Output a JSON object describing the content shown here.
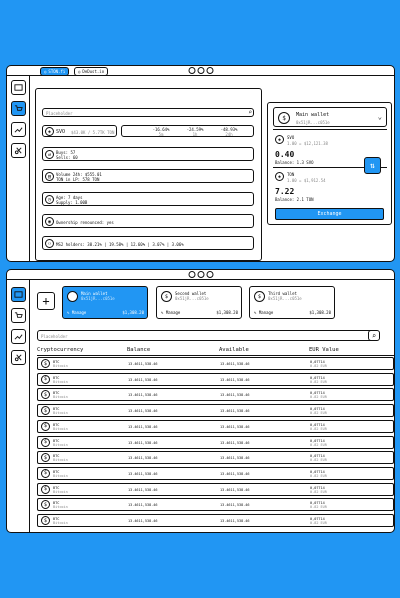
{
  "colors": {
    "accent": "#2196F3",
    "border": "#111111"
  },
  "top": {
    "tabs": [
      {
        "label": "STON.fi"
      },
      {
        "label": "DeDust.io"
      }
    ],
    "search_placeholder": "Placeholder",
    "token": {
      "symbol": "SVO",
      "price": "$43.0K / 5.7TK TON"
    },
    "changes": [
      {
        "value": "-16.64%",
        "period": "5m"
      },
      {
        "value": "-24.59%",
        "period": "1h"
      },
      {
        "value": "-48.93%",
        "period": "24h"
      }
    ],
    "stats": [
      {
        "icon": "swap-icon",
        "lines": [
          "Buys: 57",
          "Sells: 60"
        ]
      },
      {
        "icon": "chart-icon",
        "lines": [
          "Volume 24h: $555.01",
          "TON in LP: 578 TON"
        ]
      },
      {
        "icon": "clock-icon",
        "lines": [
          "Age: 7 days",
          "Supply: 1.00B"
        ]
      },
      {
        "icon": "user-icon",
        "lines": [
          "Ownership renounced: yes"
        ]
      },
      {
        "icon": "users-icon",
        "lines": [
          "MS2 holders: 30.21% | 19.58% | 12.60% | 3.07% | 3.06%"
        ]
      }
    ],
    "wallet_select": {
      "name": "Main wallet",
      "address": "0x51jR...c051e"
    },
    "assets": [
      {
        "symbol": "SVO",
        "rate": "1.00 = $12,121.38",
        "amount": "0.40",
        "balance": "Balance: 1.3 SVO"
      },
      {
        "symbol": "TON",
        "rate": "1.00 = $1,912.54",
        "amount": "7.22",
        "balance": "Balance: 2.1 TON"
      }
    ],
    "exchange_label": "Exchange"
  },
  "bottom": {
    "wallets": [
      {
        "name": "Main wallet",
        "address": "0x51jR...c051e",
        "manage": "Manage",
        "amount": "$1,308.20",
        "active": true
      },
      {
        "name": "Second wallet",
        "address": "0x51jR...c051e",
        "manage": "Manage",
        "amount": "$1,308.20",
        "active": false
      },
      {
        "name": "Third wallet",
        "address": "0x51jR...c051e",
        "manage": "Manage",
        "amount": "$1,308.20",
        "active": false
      }
    ],
    "search_placeholder": "Placeholder",
    "columns": [
      "Cryptocurrency",
      "Balance",
      "Available",
      "EUR Value"
    ],
    "rows": [
      {
        "symbol": "BTC",
        "name": "Bitcoin",
        "balance": "13.4611,538.46",
        "available": "13.4611,538.46",
        "eur": "0,07714",
        "eur_sub": "0.82 EUR"
      },
      {
        "symbol": "BTC",
        "name": "Bitcoin",
        "balance": "13.4611,538.46",
        "available": "13.4611,538.46",
        "eur": "0,07714",
        "eur_sub": "0.82 EUR"
      },
      {
        "symbol": "BTC",
        "name": "Bitcoin",
        "balance": "13.4611,538.46",
        "available": "13.4611,538.46",
        "eur": "0,07714",
        "eur_sub": "0.82 EUR"
      },
      {
        "symbol": "BTC",
        "name": "Bitcoin",
        "balance": "13.4611,538.46",
        "available": "13.4611,538.46",
        "eur": "0,07714",
        "eur_sub": "0.82 EUR"
      },
      {
        "symbol": "BTC",
        "name": "Bitcoin",
        "balance": "13.4611,538.46",
        "available": "13.4611,538.46",
        "eur": "0,07714",
        "eur_sub": "0.82 EUR"
      },
      {
        "symbol": "BTC",
        "name": "Bitcoin",
        "balance": "13.4611,538.46",
        "available": "13.4611,538.46",
        "eur": "0,07714",
        "eur_sub": "0.82 EUR"
      },
      {
        "symbol": "BTC",
        "name": "Bitcoin",
        "balance": "13.4611,538.46",
        "available": "13.4611,538.46",
        "eur": "0,07714",
        "eur_sub": "0.82 EUR"
      },
      {
        "symbol": "BTC",
        "name": "Bitcoin",
        "balance": "13.4611,538.46",
        "available": "13.4611,538.46",
        "eur": "0,07714",
        "eur_sub": "0.82 EUR"
      },
      {
        "symbol": "BTC",
        "name": "Bitcoin",
        "balance": "13.4611,538.46",
        "available": "13.4611,538.46",
        "eur": "0,07714",
        "eur_sub": "0.82 EUR"
      },
      {
        "symbol": "BTC",
        "name": "Bitcoin",
        "balance": "13.4611,538.46",
        "available": "13.4611,538.46",
        "eur": "0,07714",
        "eur_sub": "0.82 EUR"
      },
      {
        "symbol": "BTC",
        "name": "Bitcoin",
        "balance": "13.4611,538.46",
        "available": "13.4611,538.46",
        "eur": "0,07714",
        "eur_sub": "0.82 EUR"
      }
    ]
  }
}
